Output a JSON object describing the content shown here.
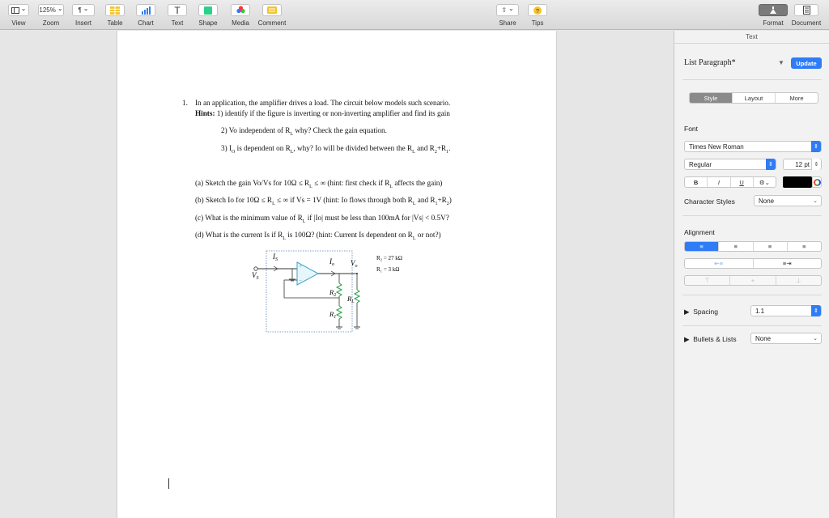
{
  "toolbar": {
    "view": "View",
    "zoom": "Zoom",
    "zoom_value": "125%",
    "insert": "Insert",
    "table": "Table",
    "chart": "Chart",
    "text": "Text",
    "shape": "Shape",
    "media": "Media",
    "comment": "Comment",
    "share": "Share",
    "tips": "Tips",
    "format": "Format",
    "document": "Document"
  },
  "document": {
    "q_num": "1.",
    "q_line1": "In an application, the amplifier drives a load. The circuit below models such scenario.",
    "hints_label": "Hints:",
    "hint1": "1) identify if the figure is inverting or non-inverting amplifier and find its gain",
    "hint2": "2) Vo independent of R",
    "hint2_sub": "L",
    "hint2_rest": " why? Check the gain equation.",
    "hint3": "3) I",
    "hint3_sub": "O",
    "hint3_mid": " is dependent on R",
    "hint3_sub2": "L",
    "hint3_rest": ", why? Io will be divided between the R",
    "hint3_sub3": "L",
    "hint3_and": " and R",
    "hint3_sub4": "2",
    "hint3_plus": "+R",
    "hint3_sub5": "1",
    "hint3_end": ".",
    "part_a": "(a) Sketch the gain Vo/Vs for 10Ω ≤ R",
    "part_a_sub": "L",
    "part_a_rest": " ≤ ∞ (hint: first check if R",
    "part_a_sub2": "L",
    "part_a_end": " affects the gain)",
    "part_b": "(b) Sketch Io for 10Ω ≤ R",
    "part_b_sub": "L",
    "part_b_rest": " ≤ ∞ if Vs = 1V (hint: Io flows through both R",
    "part_b_sub2": "L",
    "part_b_mid": " and R",
    "part_b_sub3": "1",
    "part_b_plus": "+R",
    "part_b_sub4": "2",
    "part_b_end": ")",
    "part_c": "(c) What is the minimum value of R",
    "part_c_sub": "L",
    "part_c_rest": " if |Io| must be less than 100mA for |Vs| < 0.5V?",
    "part_d": "(d) What is the current Is if R",
    "part_d_sub": "L",
    "part_d_rest": " is 100Ω? (hint: Current Is dependent on R",
    "part_d_sub2": "L",
    "part_d_end": " or not?)"
  },
  "circuit": {
    "is_label": "I",
    "is_sub": "S",
    "io_label": "I",
    "io_sub": "o",
    "vo_label": "V",
    "vo_sub": "o",
    "vs_label": "V",
    "vs_sub": "S",
    "r2_label": "R",
    "r2_sub": "2",
    "r1_label": "R",
    "r1_sub": "1",
    "rl_label": "R",
    "rl_sub": "L",
    "r2_value": "R₂ = 27 kΩ",
    "r1_value": "R₁ = 3 kΩ",
    "plus": "+",
    "minus": "−"
  },
  "inspector": {
    "header": "Text",
    "paragraph_style": "List Paragraph*",
    "update": "Update",
    "tabs": [
      "Style",
      "Layout",
      "More"
    ],
    "font_label": "Font",
    "font_family": "Times New Roman",
    "font_typeface": "Regular",
    "font_size": "12 pt",
    "bold": "B",
    "italic": "I",
    "underline": "U",
    "char_styles_label": "Character Styles",
    "char_styles_value": "None",
    "alignment_label": "Alignment",
    "spacing_label": "Spacing",
    "spacing_value": "1.1",
    "bullets_label": "Bullets & Lists",
    "bullets_value": "None",
    "text_color": "#000000",
    "accent": "#2f7cf6"
  }
}
